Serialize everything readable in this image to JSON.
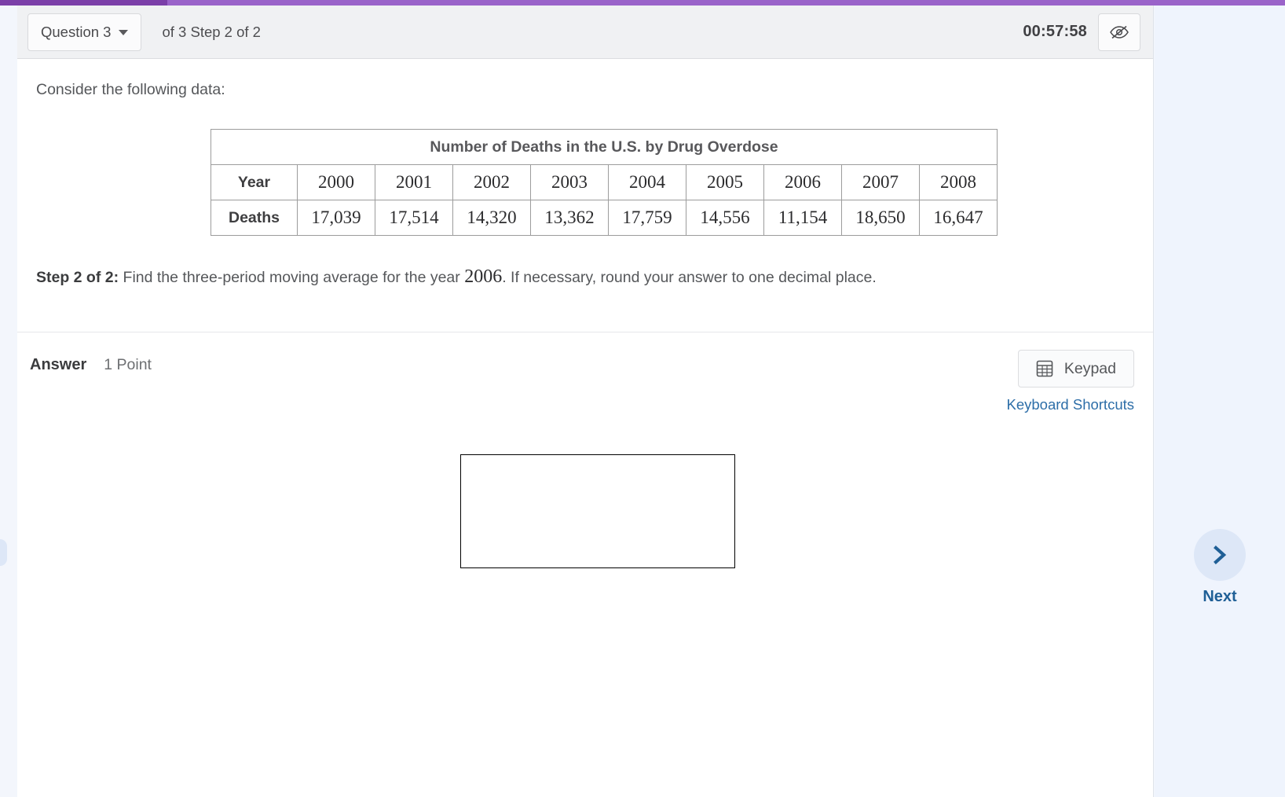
{
  "progress": {
    "percent": 13
  },
  "header": {
    "question_selector_label": "Question 3",
    "caret_icon": "chevron-down-icon",
    "step_label": "of 3 Step 2 of 2",
    "timer": "00:57:58",
    "hide_timer_icon": "eye-slash-icon"
  },
  "question": {
    "intro": "Consider the following data:",
    "table": {
      "title": "Number of Deaths in the U.S. by Drug Overdose",
      "row_headers": [
        "Year",
        "Deaths"
      ],
      "years": [
        "2000",
        "2001",
        "2002",
        "2003",
        "2004",
        "2005",
        "2006",
        "2007",
        "2008"
      ],
      "deaths": [
        "17,039",
        "17,514",
        "14,320",
        "13,362",
        "17,759",
        "14,556",
        "11,154",
        "18,650",
        "16,647"
      ]
    },
    "step_prefix": "Step 2 of 2:",
    "step_text_before": "Find the three-period moving average for the year",
    "step_year": "2006",
    "step_text_after": ". If necessary, round your answer to one decimal place."
  },
  "answer": {
    "label": "Answer",
    "points": "1 Point",
    "keypad_button": "Keypad",
    "keypad_icon": "calculator-grid-icon",
    "keyboard_shortcuts_link": "Keyboard Shortcuts",
    "input_value": "",
    "input_placeholder": ""
  },
  "navigation": {
    "next_label": "Next",
    "next_icon": "chevron-right-icon"
  },
  "chart_data": {
    "type": "table",
    "title": "Number of Deaths in the U.S. by Drug Overdose",
    "categories": [
      "2000",
      "2001",
      "2002",
      "2003",
      "2004",
      "2005",
      "2006",
      "2007",
      "2008"
    ],
    "series": [
      {
        "name": "Deaths",
        "values": [
          17039,
          17514,
          14320,
          13362,
          17759,
          14556,
          11154,
          18650,
          16647
        ]
      }
    ],
    "xlabel": "Year",
    "ylabel": "Deaths"
  },
  "colors": {
    "progress_fill": "#7b3fa8",
    "progress_track": "#9a63c9",
    "link": "#2d6ea8",
    "rail_bg": "#eff4fd",
    "next_accent": "#1f5f96"
  }
}
